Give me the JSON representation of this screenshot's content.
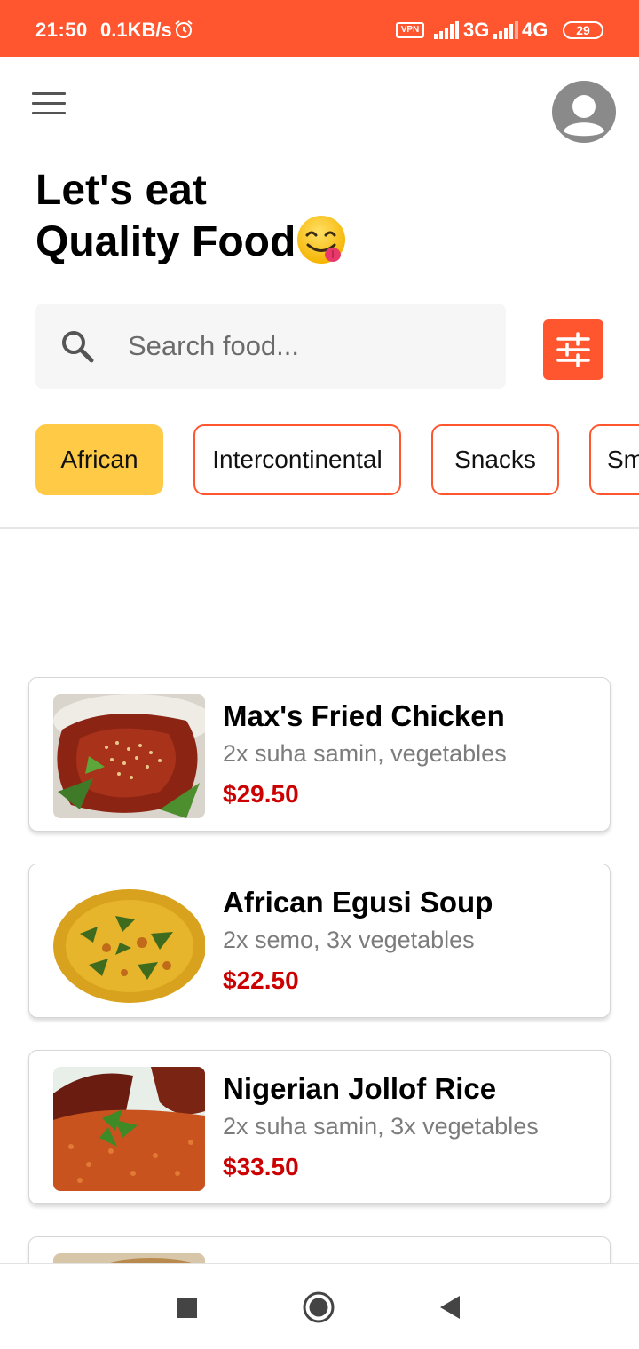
{
  "status_bar": {
    "time": "21:50",
    "speed": "0.1KB/s",
    "vpn": "VPN",
    "network1": "3G",
    "network2": "4G",
    "battery": "29",
    "background": "#ff5630"
  },
  "header": {
    "title_line1": "Let's eat",
    "title_line2": "Quality Food",
    "emoji": "face-savoring-food"
  },
  "search": {
    "placeholder": "Search food...",
    "value": ""
  },
  "categories": [
    {
      "label": "African",
      "active": true
    },
    {
      "label": "Intercontinental",
      "active": false
    },
    {
      "label": "Snacks",
      "active": false
    },
    {
      "label": "Sm",
      "active": false
    }
  ],
  "foods": [
    {
      "name": "Max's Fried Chicken",
      "description": "2x suha samin, vegetables",
      "price": "$29.50",
      "image": "fried-chicken-image"
    },
    {
      "name": "African Egusi Soup",
      "description": "2x semo, 3x vegetables",
      "price": "$22.50",
      "image": "egusi-soup-image"
    },
    {
      "name": "Nigerian Jollof Rice",
      "description": "2x suha samin, 3x vegetables",
      "price": "$33.50",
      "image": "jollof-rice-image"
    },
    {
      "name": "",
      "description": "",
      "price": "",
      "image": "partial-food-image"
    }
  ],
  "colors": {
    "accent": "#ff5630",
    "active_chip": "#ffcb47",
    "price": "#cc0000"
  },
  "nav": {
    "recents": "recents-icon",
    "home": "home-icon",
    "back": "back-icon"
  }
}
